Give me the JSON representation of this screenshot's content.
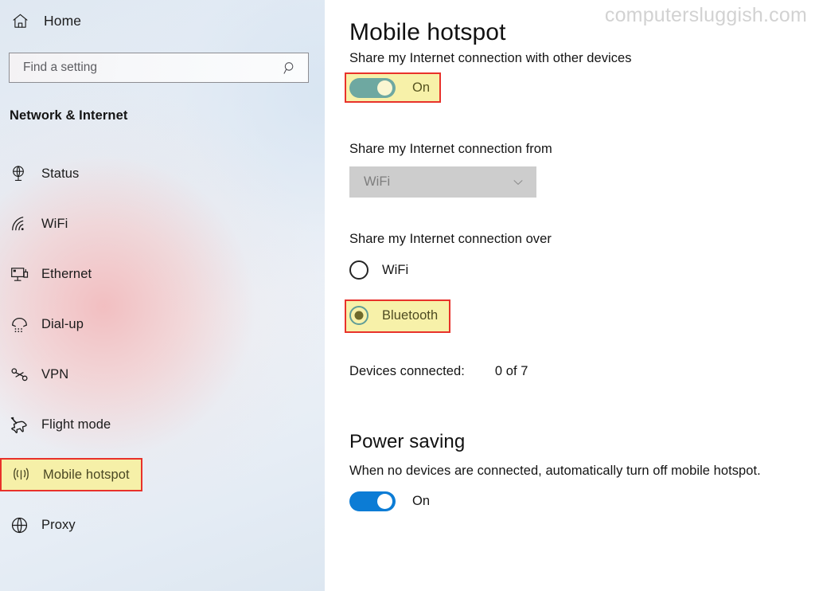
{
  "sidebar": {
    "home": {
      "label": "Home",
      "icon": "home-icon"
    },
    "search": {
      "placeholder": "Find a setting",
      "value": "",
      "icon": "search-icon"
    },
    "section_title": "Network & Internet",
    "items": [
      {
        "label": "Status",
        "icon": "globe-monitor-icon",
        "selected": false
      },
      {
        "label": "WiFi",
        "icon": "wifi-icon",
        "selected": false
      },
      {
        "label": "Ethernet",
        "icon": "ethernet-icon",
        "selected": false
      },
      {
        "label": "Dial-up",
        "icon": "dialup-phone-icon",
        "selected": false
      },
      {
        "label": "VPN",
        "icon": "vpn-icon",
        "selected": false
      },
      {
        "label": "Flight mode",
        "icon": "airplane-icon",
        "selected": false
      },
      {
        "label": "Mobile hotspot",
        "icon": "hotspot-icon",
        "selected": true
      },
      {
        "label": "Proxy",
        "icon": "globe-icon",
        "selected": false
      }
    ]
  },
  "content": {
    "page_title": "Mobile hotspot",
    "watermark": "computersluggish.com",
    "share_with_devices": {
      "label": "Share my Internet connection with other devices",
      "toggle_state": "On"
    },
    "share_from": {
      "label": "Share my Internet connection from",
      "selected_value": "WiFi",
      "disabled": true,
      "chevron": "chevron-down-icon"
    },
    "share_over": {
      "label": "Share my Internet connection over",
      "options": [
        {
          "label": "WiFi",
          "selected": false
        },
        {
          "label": "Bluetooth",
          "selected": true
        }
      ]
    },
    "devices_connected": {
      "label": "Devices connected:",
      "value": "0 of 7"
    },
    "power_saving": {
      "heading": "Power saving",
      "description": "When no devices are connected, automatically turn off mobile hotspot.",
      "toggle_state": "On"
    }
  },
  "colors": {
    "accent_blue": "#0c7cd5",
    "highlight_fill": "#f7f1a9",
    "highlight_border": "#e8322b",
    "watermark_gray": "#d2d2d2",
    "dropdown_disabled": "#cdcdcd"
  }
}
